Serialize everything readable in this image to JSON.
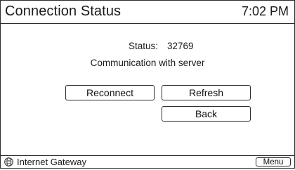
{
  "header": {
    "title": "Connection Status",
    "time": "7:02 PM"
  },
  "status": {
    "label": "Status:",
    "code": "32769"
  },
  "message": "Communication with server",
  "buttons": {
    "reconnect": "Reconnect",
    "refresh": "Refresh",
    "back": "Back"
  },
  "footer": {
    "gateway_icon": "globe-icon",
    "gateway_label": "Internet Gateway",
    "menu": "Menu"
  }
}
